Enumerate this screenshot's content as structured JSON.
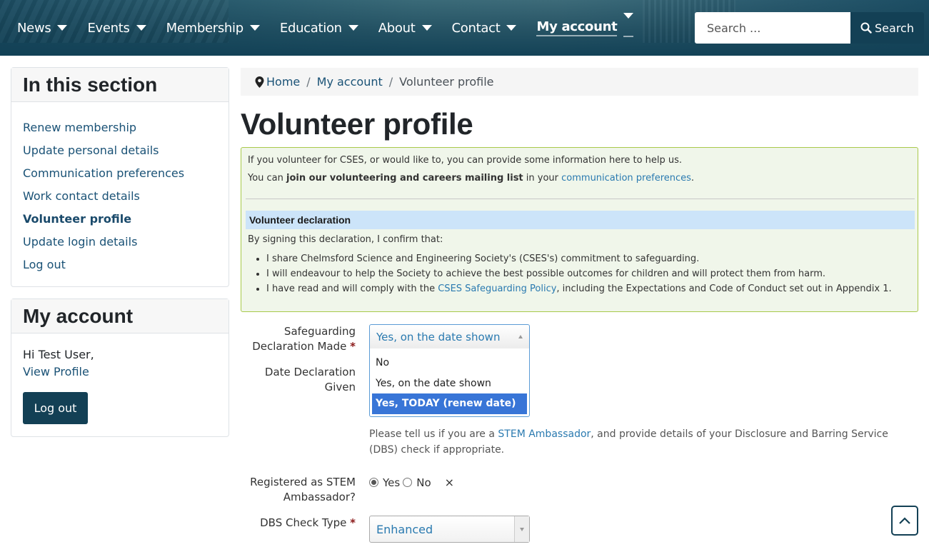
{
  "header": {
    "nav": [
      {
        "label": "News"
      },
      {
        "label": "Events"
      },
      {
        "label": "Membership"
      },
      {
        "label": "Education"
      },
      {
        "label": "About"
      },
      {
        "label": "Contact"
      },
      {
        "label": "My account",
        "active": true
      }
    ],
    "search": {
      "placeholder": "Search ...",
      "value": "",
      "button_label": "Search"
    }
  },
  "sidebar": {
    "section_title": "In this section",
    "section_items": [
      {
        "label": "Renew membership"
      },
      {
        "label": "Update personal details"
      },
      {
        "label": "Communication preferences"
      },
      {
        "label": "Work contact details"
      },
      {
        "label": "Volunteer profile",
        "current": true
      },
      {
        "label": "Update login details"
      },
      {
        "label": "Log out"
      }
    ],
    "account_title": "My account",
    "greeting": "Hi Test User,",
    "view_profile": "View Profile",
    "logout_button": "Log out"
  },
  "breadcrumb": {
    "home": "Home",
    "sep": "/",
    "parent": "My account",
    "current": "Volunteer profile"
  },
  "page": {
    "title": "Volunteer profile",
    "intro_line1": "If you volunteer for CSES, or would like to, you can provide some information here to help us.",
    "intro_line2_pre": "You can ",
    "intro_line2_bold": "join our volunteering and careers mailing list",
    "intro_line2_mid": " in your ",
    "intro_line2_link": "communication preferences",
    "intro_line2_post": ".",
    "declaration_heading": "Volunteer declaration",
    "declaration_intro": "By signing this declaration, I confirm that:",
    "declaration_items": [
      "I share Chelmsford Science and Engineering Society's (CSES's) commitment to safeguarding.",
      "I will endeavour to help the Society to achieve the best possible outcomes for children and will protect them from harm."
    ],
    "declaration_item3_pre": "I have read and will comply with the ",
    "declaration_item3_link": "CSES Safeguarding Policy",
    "declaration_item3_post": ", including the Expectations and Code of Conduct set out in Appendix 1."
  },
  "form": {
    "safeguarding": {
      "label_line1": "Safeguarding",
      "label_line2": "Declaration Made",
      "required_mark": "*",
      "selected": "Yes, on the date shown",
      "options": [
        "No",
        "Yes, on the date shown",
        "Yes, TODAY (renew date)"
      ],
      "highlighted_option": "Yes, TODAY (renew date)"
    },
    "date_given": {
      "label_line1": "Date Declaration",
      "label_line2": "Given"
    },
    "help_pre": "Please tell us if you are a ",
    "help_link": "STEM Ambassador",
    "help_post": ", and provide details of your Disclosure and Barring Service (DBS) check if appropriate.",
    "stem": {
      "label_line1": "Registered as STEM",
      "label_line2": "Ambassador?",
      "options": [
        "Yes",
        "No"
      ],
      "selected": "Yes",
      "clear": "×"
    },
    "dbs": {
      "label": "DBS Check Type",
      "required_mark": "*",
      "selected": "Enhanced"
    }
  },
  "colors": {
    "brand_dark": "#134055",
    "link": "#1a5276",
    "info_bg": "#f0f6ea",
    "info_border": "#a8c94a",
    "declaration_bg": "#cce4f9",
    "option_highlight": "#3875d7"
  }
}
